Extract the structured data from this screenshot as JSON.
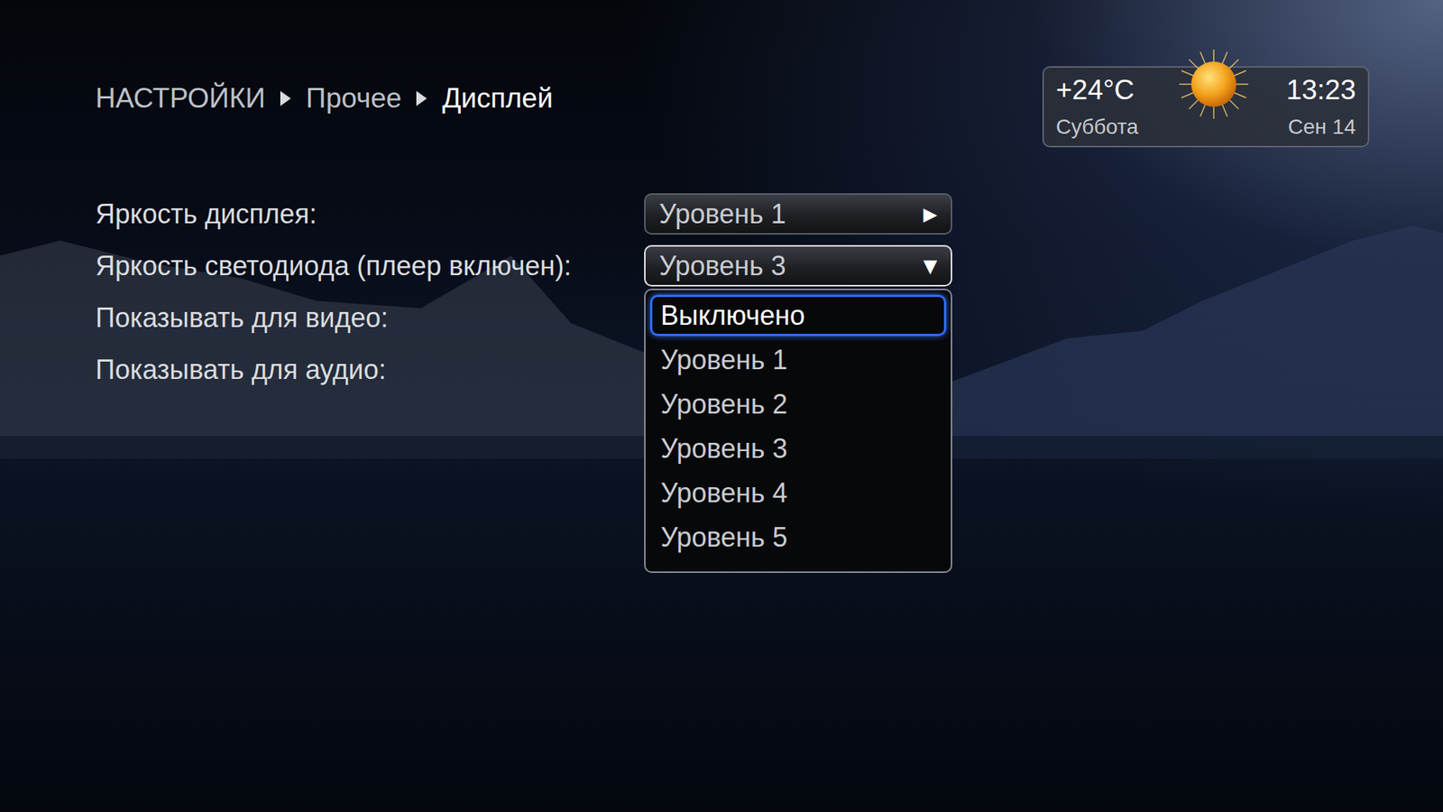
{
  "breadcrumb": [
    {
      "label": "НАСТРОЙКИ",
      "current": false
    },
    {
      "label": "Прочее",
      "current": false
    },
    {
      "label": "Дисплей",
      "current": true
    }
  ],
  "weather": {
    "temperature": "+24°C",
    "time": "13:23",
    "day": "Суббота",
    "date": "Сен 14"
  },
  "settings": [
    {
      "label": "Яркость дисплея:",
      "value": "Уровень 1",
      "arrow": "▶",
      "focused": false
    },
    {
      "label": "Яркость светодиода (плеер включен):",
      "value": "Уровень 3",
      "arrow": "▼",
      "focused": true
    },
    {
      "label": "Показывать для видео:"
    },
    {
      "label": "Показывать для аудио:"
    }
  ],
  "dropdown": {
    "options": [
      {
        "label": "Выключено",
        "selected": true
      },
      {
        "label": "Уровень 1",
        "selected": false
      },
      {
        "label": "Уровень 2",
        "selected": false
      },
      {
        "label": "Уровень 3",
        "selected": false
      },
      {
        "label": "Уровень 4",
        "selected": false
      },
      {
        "label": "Уровень 5",
        "selected": false
      }
    ]
  }
}
